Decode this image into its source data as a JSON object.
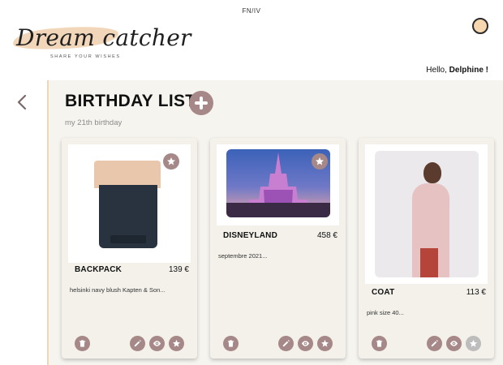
{
  "header": {
    "language": "FN/IV",
    "logo": {
      "title": "Dream catcher",
      "tagline": "SHARE YOUR WISHES"
    },
    "greeting_prefix": "Hello, ",
    "user_name": "Delphine !"
  },
  "list": {
    "title": "BIRTHDAY LIST",
    "subtitle": "my 21th birthday"
  },
  "cards": [
    {
      "name": "BACKPACK",
      "price": "139 €",
      "description": "helsinki navy blush Kapten & Son..."
    },
    {
      "name": "DISNEYLAND",
      "price": "458 €",
      "description": "septembre 2021..."
    },
    {
      "name": "COAT",
      "price": "113 €",
      "description": "pink size 40..."
    }
  ],
  "icons": {
    "back": "chevron-left-icon",
    "add": "plus-circle-icon",
    "delete": "trash-icon",
    "edit": "pencil-icon",
    "view": "eye-icon",
    "favorite": "star-icon",
    "profile": "avatar-icon"
  },
  "colors": {
    "accent": "#a58887",
    "panel": "#f6f4ef",
    "card": "#f3f1ea",
    "logo_swash": "#f1d2b3",
    "inactive": "#bdbdbd"
  }
}
